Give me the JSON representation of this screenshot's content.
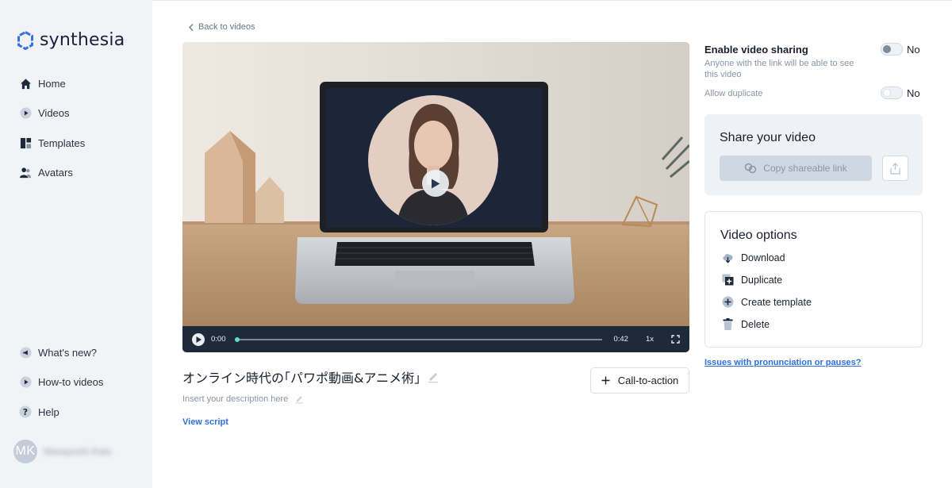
{
  "brand": {
    "name": "synthesia"
  },
  "sidebar": {
    "items": [
      {
        "label": "Home",
        "icon": "home-icon"
      },
      {
        "label": "Videos",
        "icon": "play-circle-icon"
      },
      {
        "label": "Templates",
        "icon": "templates-icon"
      },
      {
        "label": "Avatars",
        "icon": "avatars-icon"
      }
    ],
    "bottom_items": [
      {
        "label": "What's new?",
        "icon": "megaphone-icon"
      },
      {
        "label": "How-to videos",
        "icon": "play-circle-icon"
      },
      {
        "label": "Help",
        "icon": "help-icon"
      }
    ],
    "user": {
      "initials": "MK",
      "name": "Masayoshi Kato"
    }
  },
  "main": {
    "back_label": "Back to videos",
    "player": {
      "current_time": "0:00",
      "duration": "0:42",
      "speed": "1x",
      "progress": 0.0
    },
    "video_title": "オンライン時代の｢パワポ動画&アニメ術｣",
    "description_placeholder": "Insert your description here",
    "view_script_label": "View script",
    "cta_label": "Call-to-action"
  },
  "right": {
    "sharing": {
      "label": "Enable video sharing",
      "hint": "Anyone with the link will be able to see this video",
      "state": "No"
    },
    "duplicate": {
      "label": "Allow duplicate",
      "state": "No"
    },
    "share_card": {
      "title": "Share your video",
      "copy_label": "Copy shareable link"
    },
    "options": {
      "title": "Video options",
      "items": [
        {
          "label": "Download",
          "icon": "cloud-download-icon"
        },
        {
          "label": "Duplicate",
          "icon": "duplicate-icon"
        },
        {
          "label": "Create template",
          "icon": "plus-circle-icon"
        },
        {
          "label": "Delete",
          "icon": "trash-icon"
        }
      ]
    },
    "issues_link": "Issues with pronunciation or pauses?"
  },
  "colors": {
    "accent": "#2d6fe0",
    "progress": "#5be0c0",
    "sidebar_bg": "#f1f3f7",
    "player_bar": "#1e2a3a"
  }
}
